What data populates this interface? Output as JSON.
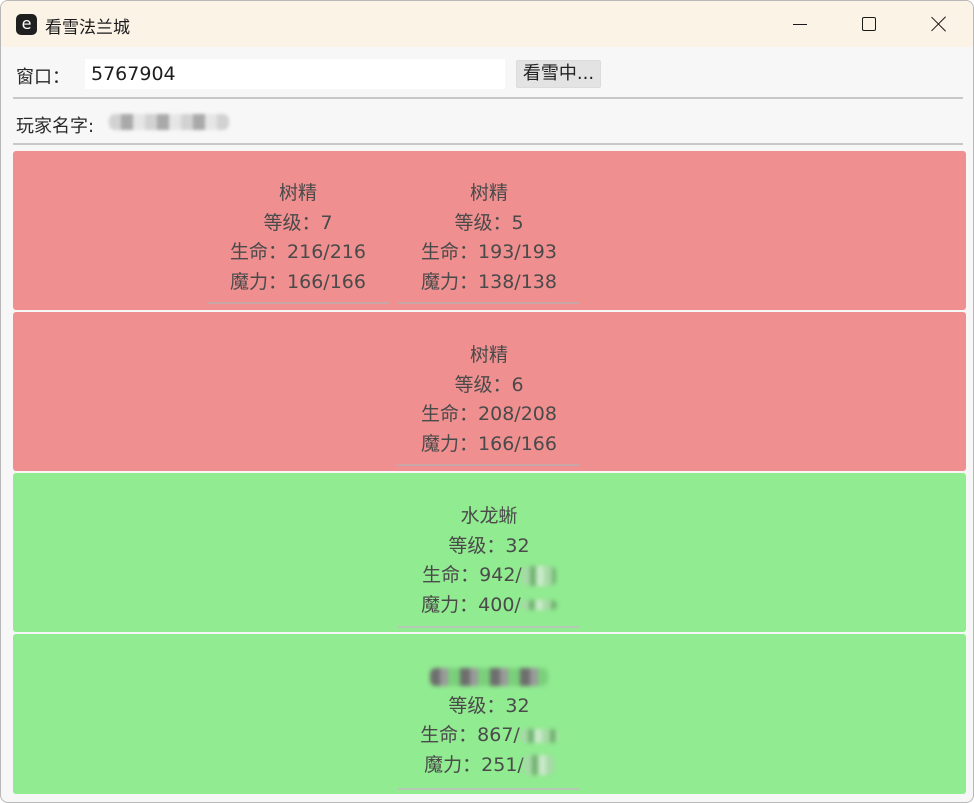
{
  "app": {
    "icon_letter": "e",
    "title": "看雪法兰城"
  },
  "toolbar": {
    "window_label": "窗口：",
    "window_value": "5767904",
    "watch_button": "看雪中..."
  },
  "player": {
    "label": "玩家名字:"
  },
  "colors": {
    "enemy_panel": "#ef8f8f",
    "ally_panel": "#91eb91"
  },
  "enemy_rows": [
    {
      "units": [
        {
          "name": "树精",
          "level": "等级：7",
          "hp": "生命：216/216",
          "mp": "魔力：166/166"
        },
        {
          "name": "树精",
          "level": "等级：5",
          "hp": "生命：193/193",
          "mp": "魔力：138/138"
        }
      ]
    },
    {
      "units": [
        {
          "name": "树精",
          "level": "等级：6",
          "hp": "生命：208/208",
          "mp": "魔力：166/166"
        }
      ]
    }
  ],
  "ally_rows": [
    {
      "units": [
        {
          "name": "水龙蜥",
          "level": "等级：32",
          "hp": "生命：942/",
          "mp": "魔力：400/"
        }
      ]
    },
    {
      "units": [
        {
          "name": "",
          "level": "等级：32",
          "hp": "生命：867/",
          "mp": "魔力：251/"
        }
      ]
    }
  ]
}
